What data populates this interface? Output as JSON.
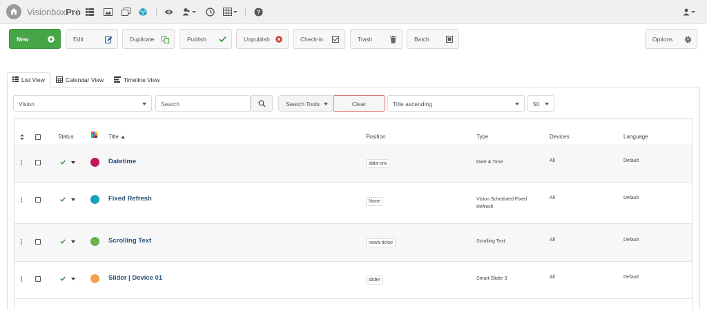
{
  "app": {
    "brand_light": "Visionbox",
    "brand_bold": "Pro"
  },
  "toolbar": {
    "new": "New",
    "edit": "Edit",
    "duplicate": "Duplicate",
    "publish": "Publish",
    "unpublish": "Unpublish",
    "checkin": "Check-in",
    "trash": "Trash",
    "batch": "Batch",
    "options": "Options"
  },
  "tabs": {
    "list": "List View",
    "calendar": "Calendar View",
    "timeline": "Timeline View"
  },
  "filters": {
    "category": "Vision",
    "search_placeholder": "Search",
    "search_tools": "Search Tools",
    "clear": "Clear",
    "sort": "Title ascending",
    "limit": "50"
  },
  "table": {
    "headers": {
      "status": "Status",
      "title": "Title",
      "position": "Position",
      "type": "Type",
      "devices": "Devices",
      "language": "Language"
    },
    "rows": [
      {
        "color": "#c2185b",
        "title": "Datetime",
        "position": "data-ora",
        "type": "Date & Time",
        "devices": "All",
        "language": "Default"
      },
      {
        "color": "#17a2b8",
        "title": "Fixed Refresh",
        "position": "None",
        "type": "Vision Scheduled Fixed Refresh",
        "devices": "All",
        "language": "Default"
      },
      {
        "color": "#6ab04c",
        "title": "Scrolling Text",
        "position": "news-ticker",
        "type": "Scrolling Text",
        "devices": "All",
        "language": "Default"
      },
      {
        "color": "#f0a050",
        "title": "Slider | Device 01",
        "position": "slider",
        "type": "Smart Slider 3",
        "devices": "All",
        "language": "Default"
      }
    ]
  },
  "colors": {
    "new_button": "#46a546",
    "title_link": "#2a5279",
    "check": "#3a9a3a",
    "clear_border": "#e06d6d"
  }
}
